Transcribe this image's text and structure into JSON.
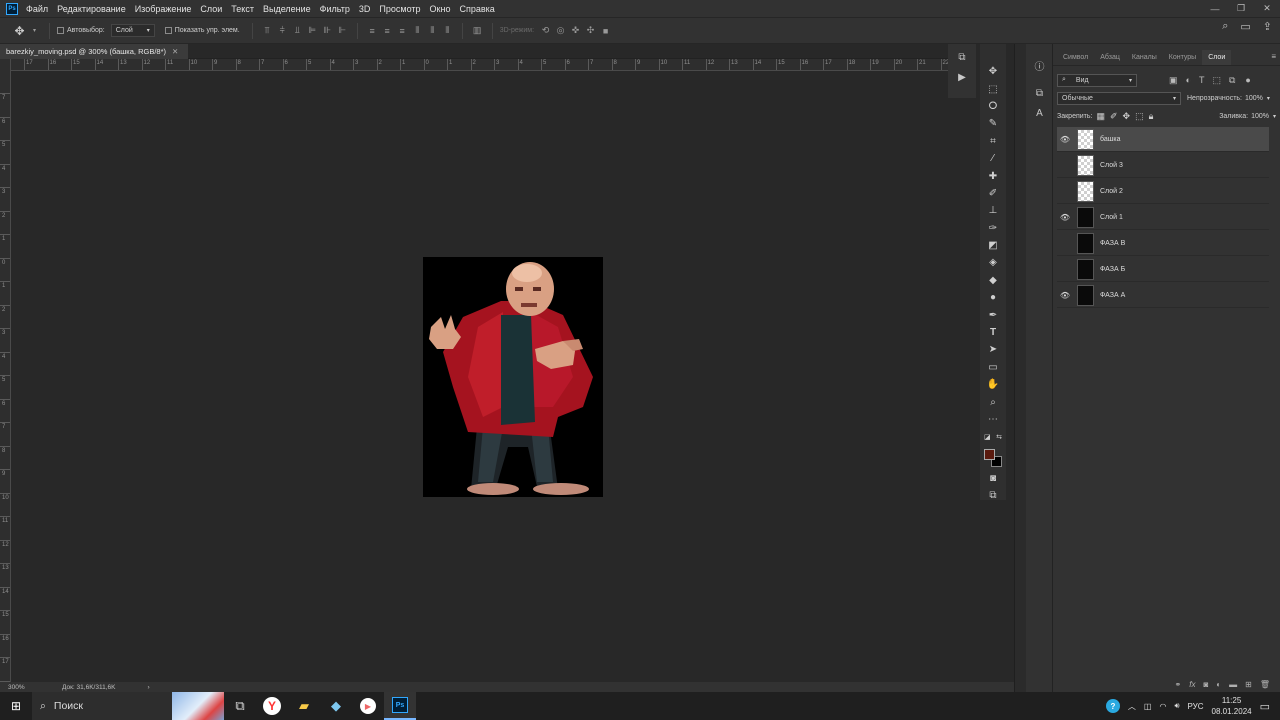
{
  "menubar": {
    "items": [
      "Файл",
      "Редактирование",
      "Изображение",
      "Слои",
      "Текст",
      "Выделение",
      "Фильтр",
      "3D",
      "Просмотр",
      "Окно",
      "Справка"
    ]
  },
  "options_bar": {
    "autoselect_label": "Автовыбор:",
    "autoselect_value": "Слой",
    "show_transform_label": "Показать упр. элем.",
    "mode_3d_label": "3D-режим:"
  },
  "document": {
    "tab_title": "barezkiy_moving.psd @ 300% (башка, RGB/8*)"
  },
  "ruler_h": [
    "17",
    "16",
    "15",
    "14",
    "13",
    "12",
    "11",
    "10",
    "9",
    "8",
    "7",
    "6",
    "5",
    "4",
    "3",
    "2",
    "1",
    "0",
    "1",
    "2",
    "3",
    "4",
    "5",
    "6",
    "7",
    "8",
    "9",
    "10",
    "11",
    "12",
    "13",
    "14",
    "15",
    "16",
    "17",
    "18",
    "19",
    "20",
    "21",
    "22"
  ],
  "ruler_v": [
    "7",
    "6",
    "5",
    "4",
    "3",
    "2",
    "1",
    "0",
    "1",
    "2",
    "3",
    "4",
    "5",
    "6",
    "7",
    "8",
    "9",
    "10",
    "11",
    "12",
    "13",
    "14",
    "15",
    "16",
    "17",
    "18",
    "19"
  ],
  "status": {
    "zoom": "300%",
    "doc_size": "Док: 31,6K/311,6K"
  },
  "panel": {
    "tabs": [
      "Символ",
      "Абзац",
      "Каналы",
      "Контуры",
      "Слои"
    ],
    "active_tab": "Слои",
    "filter_label": "Вид",
    "blend_mode": "Обычные",
    "opacity_label": "Непрозрачность:",
    "opacity_value": "100%",
    "lock_label": "Закрепить:",
    "fill_label": "Заливка:",
    "fill_value": "100%",
    "layers": [
      {
        "name": "башка",
        "visible": true,
        "selected": true
      },
      {
        "name": "Слой 3",
        "visible": false,
        "selected": false
      },
      {
        "name": "Слой 2",
        "visible": false,
        "selected": false
      },
      {
        "name": "Слой 1",
        "visible": true,
        "selected": false
      },
      {
        "name": "ФАЗА В",
        "visible": false,
        "selected": false
      },
      {
        "name": "ФАЗА Б",
        "visible": false,
        "selected": false
      },
      {
        "name": "ФАЗА А",
        "visible": true,
        "selected": false
      }
    ]
  },
  "colors": {
    "foreground": "#5a1a0e",
    "background": "#000000"
  },
  "taskbar": {
    "search_placeholder": "Поиск",
    "language": "РУС",
    "time": "11:25",
    "date": "08.01.2024"
  }
}
